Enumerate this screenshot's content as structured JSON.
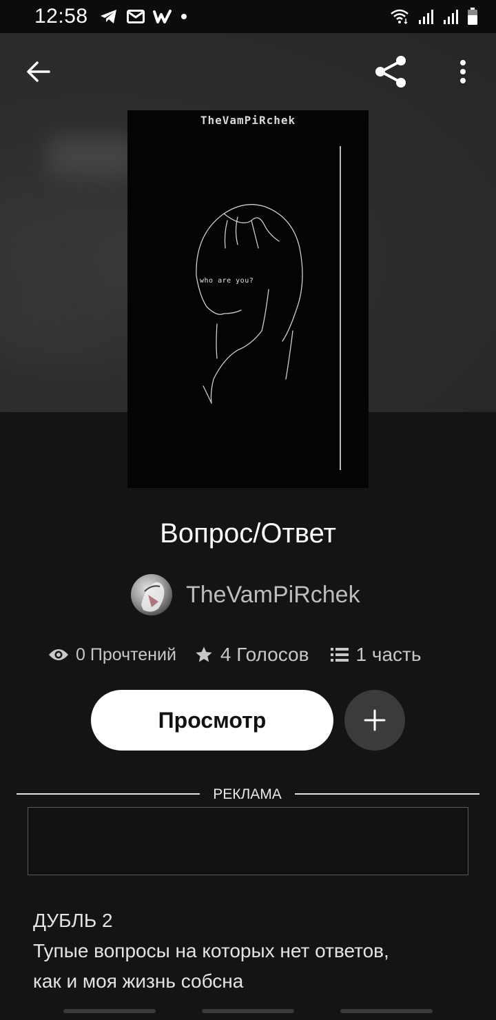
{
  "status_bar": {
    "time": "12:58",
    "left_icons": [
      "telegram-icon",
      "mail-icon",
      "w-app-icon",
      "dot-icon"
    ],
    "right_icons": [
      "wifi-icon",
      "signal-icon",
      "signal-icon",
      "battery-icon"
    ]
  },
  "app_bar": {
    "icons": [
      "back-arrow-icon",
      "share-icon",
      "more-vert-icon"
    ]
  },
  "cover": {
    "author_text": "TheVamPiRchek",
    "caption": "who are you?"
  },
  "story": {
    "title": "Вопрос/Ответ",
    "author": "TheVamPiRchek",
    "stats": {
      "reads": "0 Прочтений",
      "votes": "4 Голосов",
      "parts": "1 часть"
    },
    "read_button": "Просмотр",
    "add_button_icon": "plus-icon"
  },
  "ad": {
    "label": "РЕКЛАМА"
  },
  "description": {
    "line1": "ДУБЛЬ 2",
    "line2": "Тупые вопросы на которых нет ответов,",
    "line3": "как и моя жизнь собсна"
  },
  "colors": {
    "background": "#141315",
    "hero": "#2e2e2e",
    "button_primary": "#ffffff",
    "button_secondary": "#3b3b3d",
    "muted_text": "#bdbdbd"
  }
}
